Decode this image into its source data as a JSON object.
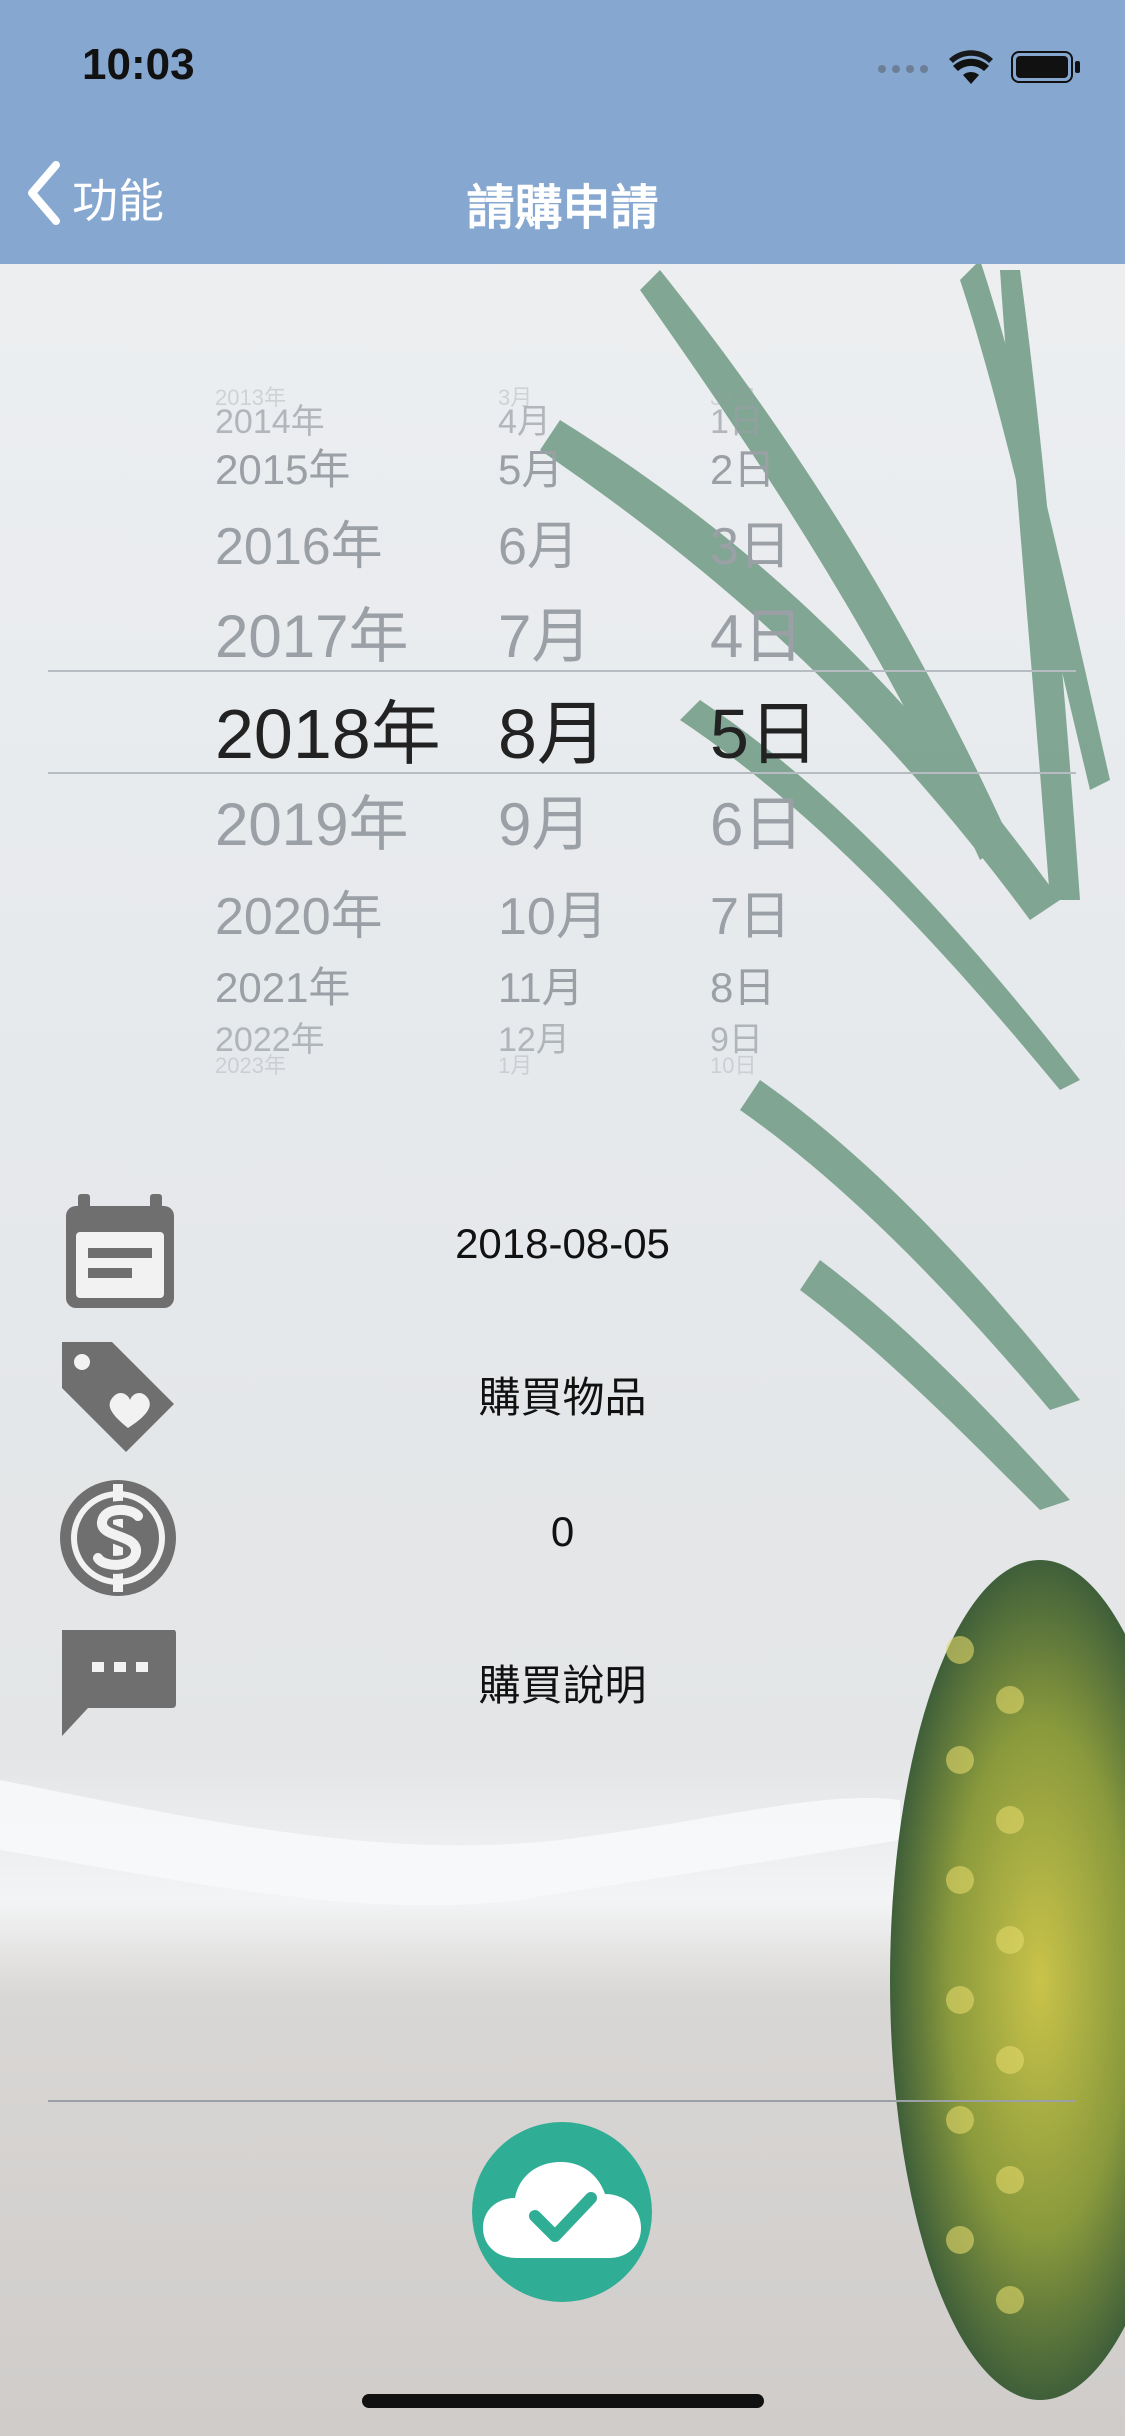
{
  "status_bar": {
    "time": "10:03",
    "icons": [
      "signal-dots-icon",
      "wifi-icon",
      "battery-icon"
    ]
  },
  "nav": {
    "back_label": "功能",
    "title": "請購申請"
  },
  "picker": {
    "years": [
      "2013年",
      "2014年",
      "2015年",
      "2016年",
      "2017年",
      "2018年",
      "2019年",
      "2020年",
      "2021年",
      "2022年",
      "2023年"
    ],
    "months": [
      "3月",
      "4月",
      "5月",
      "6月",
      "7月",
      "8月",
      "9月",
      "10月",
      "11月",
      "12月",
      "1月"
    ],
    "days": [
      "31日",
      "1日",
      "2日",
      "3日",
      "4日",
      "5日",
      "6日",
      "7日",
      "8日",
      "9日",
      "10日"
    ],
    "selected": {
      "year": "2018年",
      "month": "8月",
      "day": "5日"
    }
  },
  "form": {
    "date": {
      "icon": "calendar-icon",
      "value": "2018-08-05"
    },
    "item": {
      "icon": "tag-heart-icon",
      "value": "購買物品"
    },
    "amount": {
      "icon": "dollar-icon",
      "value": "0"
    },
    "description": {
      "icon": "chat-bubble-icon",
      "value": "購買說明"
    }
  },
  "submit": {
    "icon": "cloud-check-icon"
  },
  "colors": {
    "nav_bg": "#86a8d0",
    "icon_gray": "#6f6f6f",
    "submit_green": "#2fae95"
  }
}
